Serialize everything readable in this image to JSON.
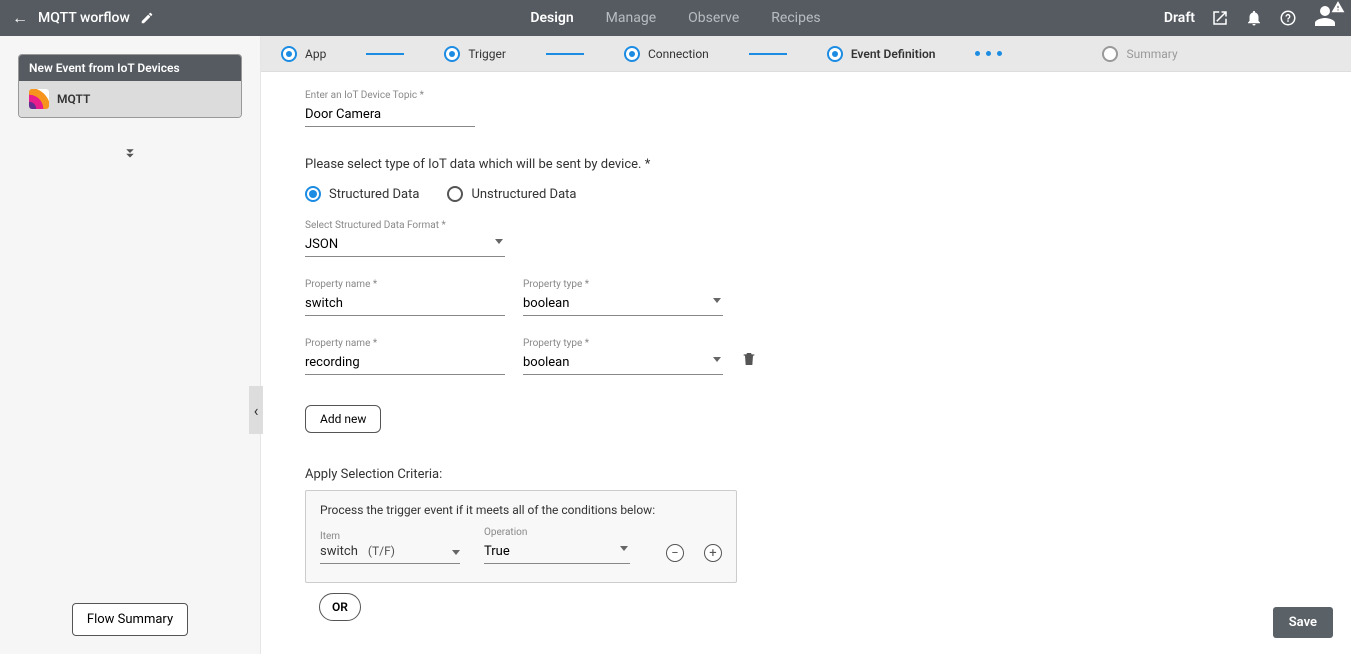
{
  "header": {
    "title": "MQTT worflow",
    "status": "Draft",
    "tabs": [
      "Design",
      "Manage",
      "Observe",
      "Recipes"
    ],
    "active_tab": 0
  },
  "sidebar": {
    "card_title": "New Event from IoT Devices",
    "card_app": "MQTT",
    "flow_summary_btn": "Flow Summary"
  },
  "stepper": {
    "steps": [
      "App",
      "Trigger",
      "Connection",
      "Event Definition",
      "Summary"
    ]
  },
  "form": {
    "topic_label": "Enter an IoT Device Topic *",
    "topic_value": "Door Camera",
    "data_type_prompt": "Please select type of IoT data which will be sent by device. *",
    "radio_structured": "Structured Data",
    "radio_unstructured": "Unstructured Data",
    "format_label": "Select Structured Data Format *",
    "format_value": "JSON",
    "property_name_label": "Property name *",
    "property_type_label": "Property type *",
    "properties": [
      {
        "name": "switch",
        "type": "boolean"
      },
      {
        "name": "recording",
        "type": "boolean"
      }
    ],
    "add_new_btn": "Add new",
    "criteria_title": "Apply Selection Criteria:",
    "criteria_desc": "Process the trigger event if it meets all of the conditions below:",
    "criteria_item_label": "Item",
    "criteria_item_value": "switch",
    "criteria_item_tf": "(T/F)",
    "criteria_op_label": "Operation",
    "criteria_op_value": "True",
    "or_btn": "OR",
    "save_btn": "Save"
  }
}
